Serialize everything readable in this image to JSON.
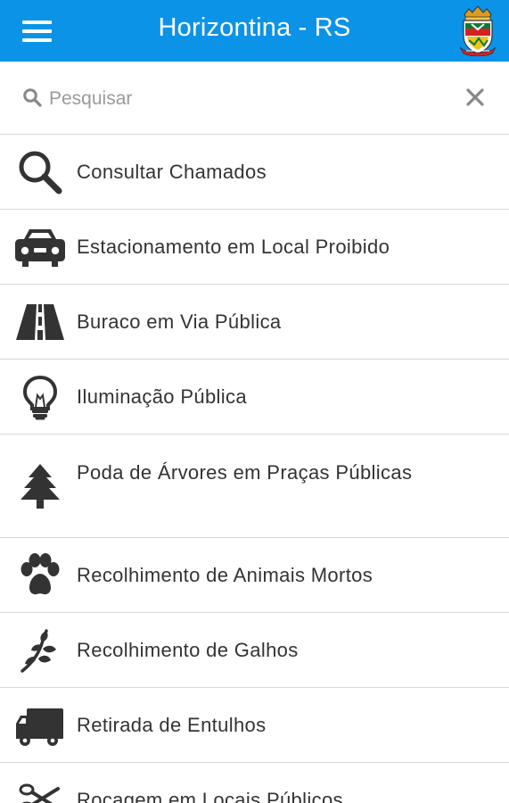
{
  "header": {
    "title": "Horizontina - RS"
  },
  "search": {
    "placeholder": "Pesquisar"
  },
  "icons": {
    "menu": "menu-icon",
    "search": "search-icon",
    "clear": "close-icon",
    "crest": "municipal-crest-icon"
  },
  "colors": {
    "header_background": "#0b93e8",
    "text": "#333333",
    "divider": "#d8d8d8"
  },
  "items": [
    {
      "label": "Consultar Chamados",
      "icon": "magnifier-icon"
    },
    {
      "label": "Estacionamento em Local Proibido",
      "icon": "car-icon"
    },
    {
      "label": "Buraco em Via Pública",
      "icon": "road-icon"
    },
    {
      "label": "Iluminação Pública",
      "icon": "lightbulb-icon"
    },
    {
      "label": "Poda de Árvores em Praças Públicas",
      "icon": "tree-icon"
    },
    {
      "label": "Recolhimento de Animais Mortos",
      "icon": "paw-icon"
    },
    {
      "label": "Recolhimento de Galhos",
      "icon": "branch-icon"
    },
    {
      "label": "Retirada de Entulhos",
      "icon": "truck-icon"
    },
    {
      "label": "Roçagem em Locais Públicos",
      "icon": "scissors-icon"
    }
  ]
}
